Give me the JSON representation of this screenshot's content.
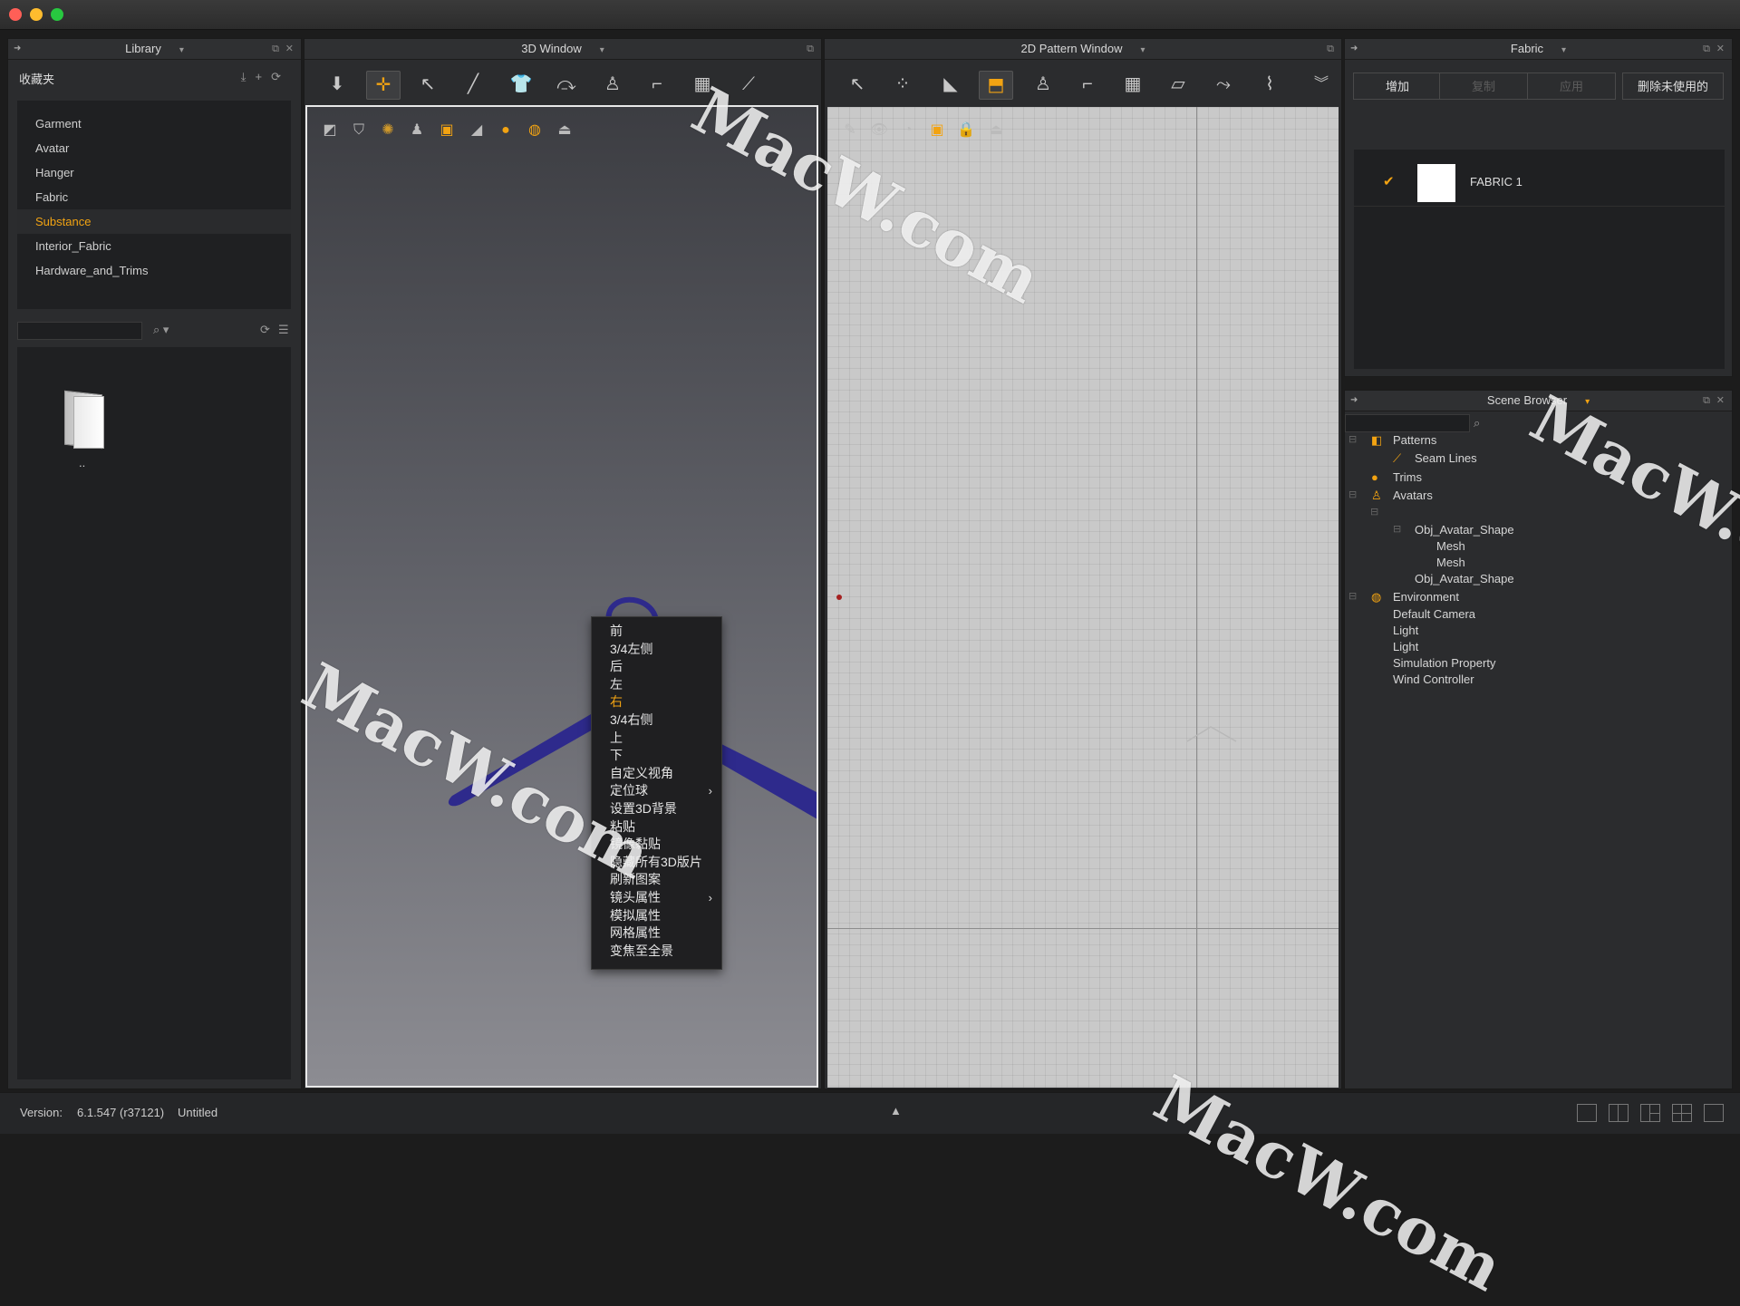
{
  "library": {
    "title": "Library",
    "favorites_label": "收藏夹",
    "items": [
      "Garment",
      "Avatar",
      "Hanger",
      "Fabric",
      "Substance",
      "Interior_Fabric",
      "Hardware_and_Trims"
    ],
    "selected_index": 4,
    "folder_label": ".."
  },
  "window3d": {
    "title": "3D Window"
  },
  "window2d": {
    "title": "2D Pattern Window"
  },
  "fabric": {
    "title": "Fabric",
    "buttons": {
      "add": "增加",
      "copy": "复制",
      "apply": "应用",
      "delete_unused": "删除未使用的"
    },
    "item_label": "FABRIC 1"
  },
  "scene": {
    "title": "Scene Browser",
    "nodes": {
      "patterns": "Patterns",
      "seam_lines": "Seam Lines",
      "trims": "Trims",
      "avatars": "Avatars",
      "obj_shape_1": "Obj_Avatar_Shape",
      "mesh_1": "Mesh",
      "mesh_2": "Mesh",
      "obj_shape_2": "Obj_Avatar_Shape",
      "environment": "Environment",
      "default_camera": "Default Camera",
      "light_1": "Light",
      "light_2": "Light",
      "sim_property": "Simulation Property",
      "wind_controller": "Wind Controller"
    }
  },
  "context_menu": {
    "items": [
      "前",
      "3/4左侧",
      "后",
      "左",
      "右",
      "3/4右侧",
      "上",
      "下",
      "自定义视角",
      "定位球",
      "设置3D背景",
      "粘贴",
      "镜像黏贴",
      "隐藏所有3D版片",
      "刷新图案",
      "镜头属性",
      "模拟属性",
      "网格属性",
      "变焦至全景"
    ],
    "highlighted_index": 4,
    "submenu_indices": [
      9,
      15
    ]
  },
  "status": {
    "version_label": "Version:",
    "version": "6.1.547 (r37121)",
    "file": "Untitled"
  },
  "watermark": "MacW.com",
  "colors": {
    "accent": "#f2a312",
    "hanger": "#2e2a8c",
    "grid_bg": "#c9c9c9"
  }
}
